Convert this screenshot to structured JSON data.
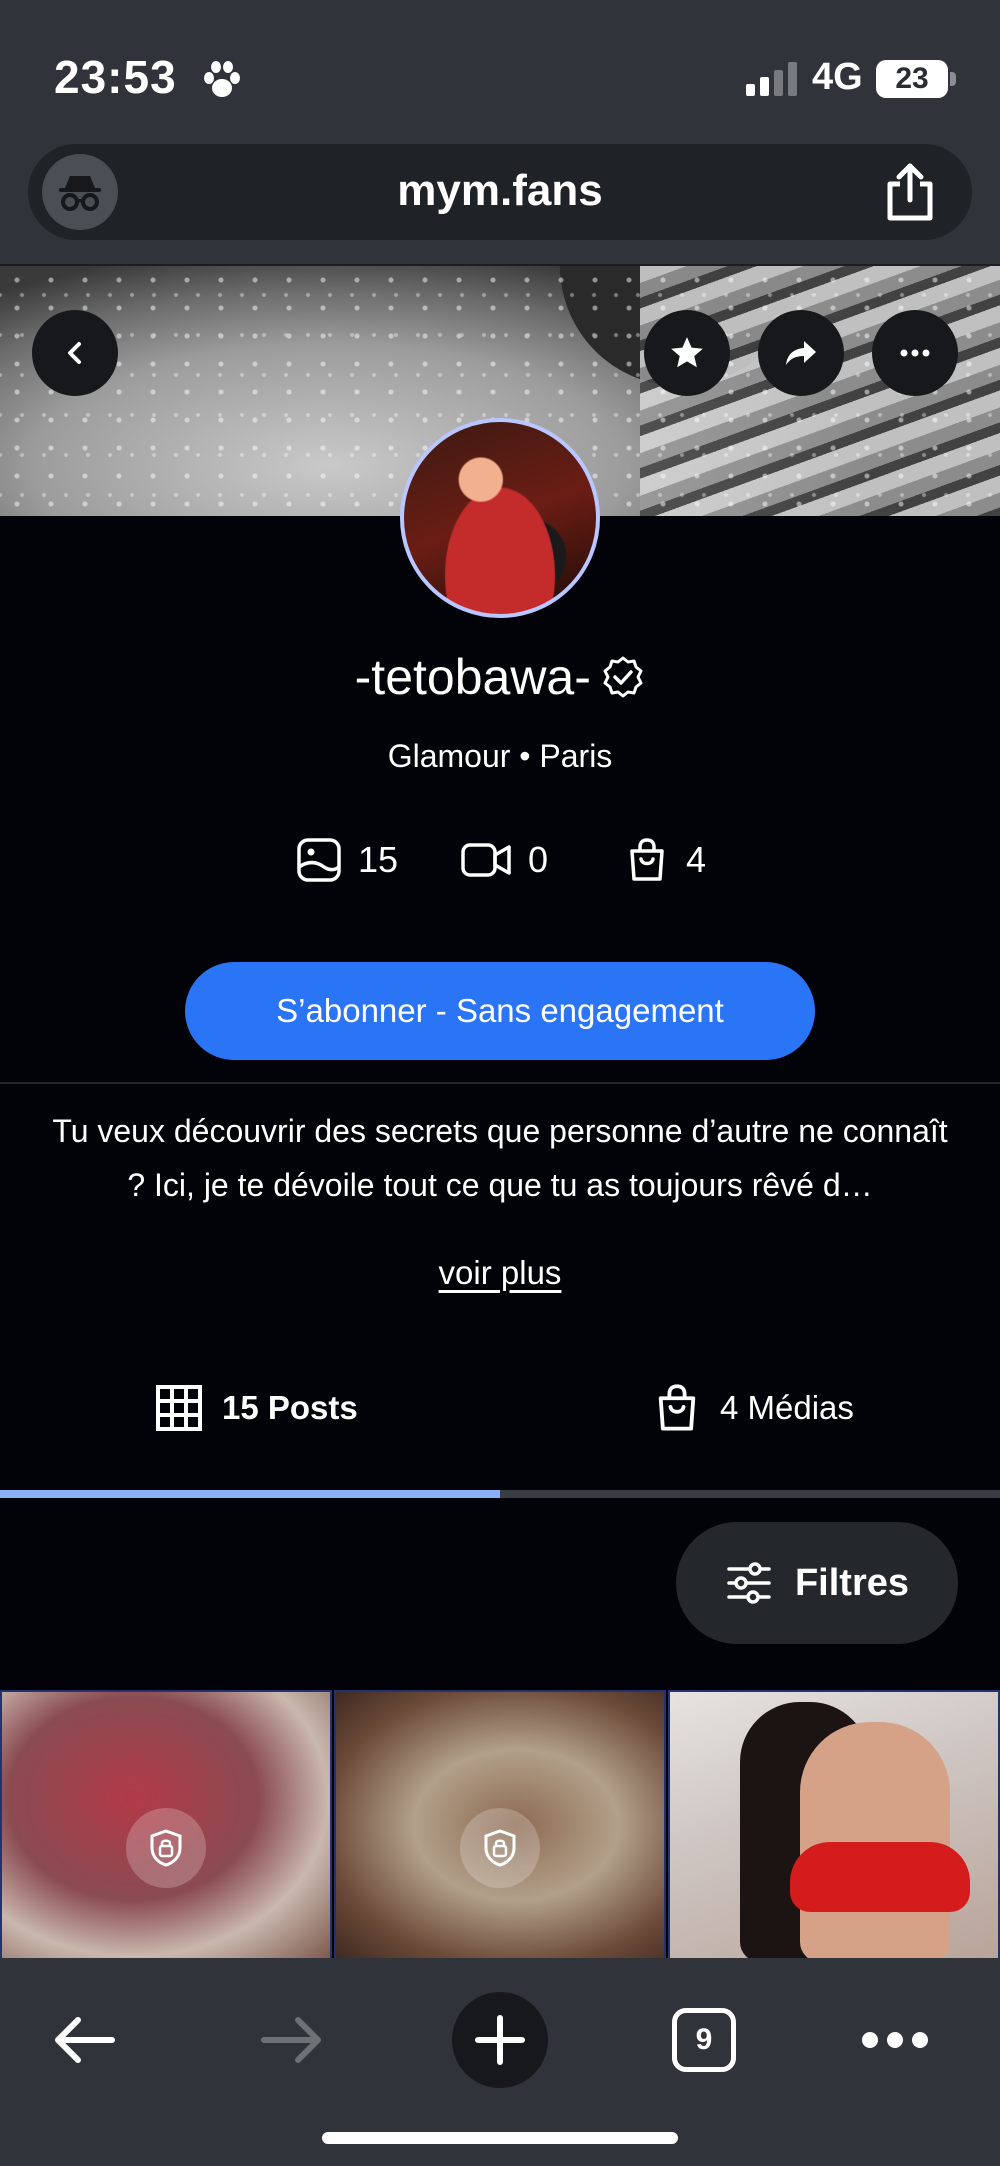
{
  "status_bar": {
    "time": "23:53",
    "network": "4G",
    "battery": "23"
  },
  "browser": {
    "url": "mym.fans",
    "tab_count": "9"
  },
  "profile": {
    "username": "-tetobawa-",
    "subtitle": "Glamour • Paris",
    "stats": {
      "photos": "15",
      "videos": "0",
      "medias": "4"
    },
    "subscribe_label": "S’abonner - Sans engagement",
    "bio": "Tu veux découvrir des secrets que personne d’autre ne connaît ? Ici, je te dévoile tout ce que tu as toujours rêvé d…",
    "see_more_label": "voir plus"
  },
  "tabs": [
    {
      "label": "15 Posts",
      "icon": "grid-icon",
      "active": true
    },
    {
      "label": "4 Médias",
      "icon": "bag-icon",
      "active": false
    }
  ],
  "filters_label": "Filtres",
  "colors": {
    "accent": "#2a74f6",
    "tab_indicator": "#8cb0f7",
    "background": "#020308",
    "chrome": "#30343a"
  }
}
